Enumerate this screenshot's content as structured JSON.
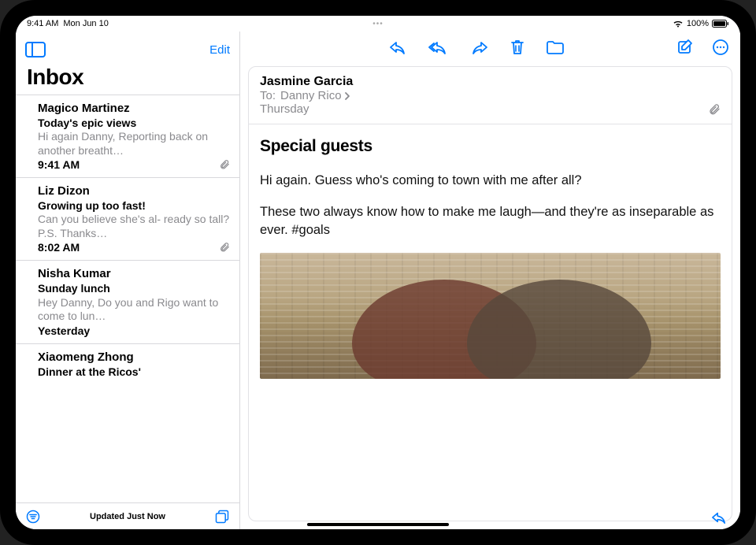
{
  "status": {
    "time": "9:41 AM",
    "date": "Mon Jun 10",
    "battery_pct": "100%"
  },
  "sidebar": {
    "edit_label": "Edit",
    "title": "Inbox",
    "footer_status": "Updated Just Now",
    "messages": [
      {
        "sender": "Magico Martinez",
        "subject": "Today's epic views",
        "preview": "Hi again Danny, Reporting back on another breatht…",
        "time": "9:41 AM",
        "has_attachment": true
      },
      {
        "sender": "Liz Dizon",
        "subject": "Growing up too fast!",
        "preview": "Can you believe she's al- ready so tall? P.S. Thanks…",
        "time": "8:02 AM",
        "has_attachment": true
      },
      {
        "sender": "Nisha Kumar",
        "subject": "Sunday lunch",
        "preview": "Hey Danny, Do you and Rigo want to come to lun…",
        "time": "Yesterday",
        "has_attachment": false
      },
      {
        "sender": "Xiaomeng Zhong",
        "subject": "Dinner at the Ricos'",
        "preview": "",
        "time": "",
        "has_attachment": false
      }
    ]
  },
  "reader": {
    "from": "Jasmine Garcia",
    "to_label": "To:",
    "to_name": "Danny Rico",
    "date": "Thursday",
    "has_attachment": true,
    "subject": "Special guests",
    "paragraphs": [
      "Hi again. Guess who's coming to town with me after all?",
      "These two always know how to make me laugh—and they're as inseparable as ever. #goals"
    ]
  }
}
